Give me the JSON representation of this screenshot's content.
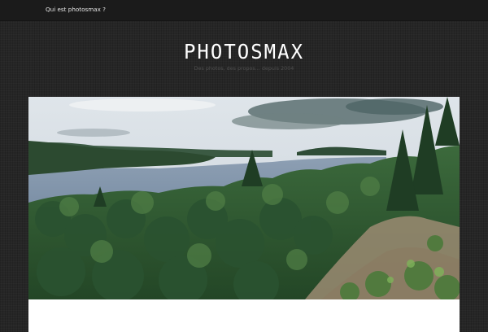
{
  "nav": {
    "about_link": "Qui est photosmax ?"
  },
  "header": {
    "site_title": "PHOTOSMAX",
    "tagline": "Des photos, des propos... depuis 2004"
  },
  "colors": {
    "background": "#262626",
    "topbar": "#1b1b1b",
    "title": "#ffffff",
    "tagline": "#4f4f4f",
    "card": "#ffffff"
  }
}
